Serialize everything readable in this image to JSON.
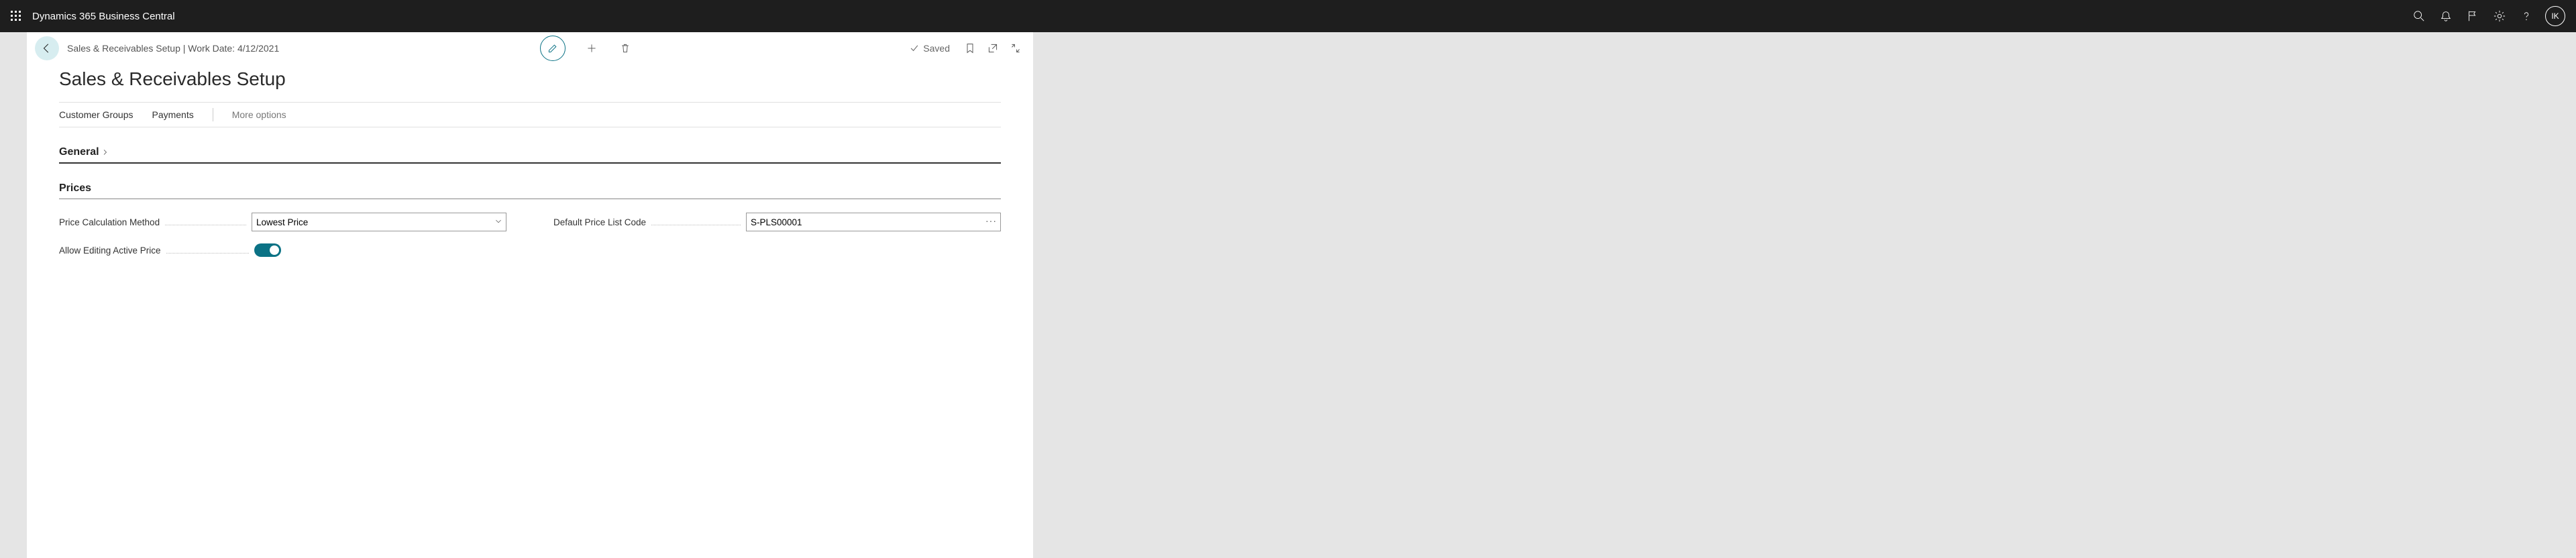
{
  "topbar": {
    "app_title": "Dynamics 365 Business Central",
    "user_initials": "IK"
  },
  "page": {
    "breadcrumb": "Sales & Receivables Setup | Work Date: 4/12/2021",
    "title": "Sales & Receivables Setup",
    "saved_label": "Saved"
  },
  "tabs": {
    "items": [
      "Customer Groups",
      "Payments"
    ],
    "more": "More options"
  },
  "sections": {
    "general": "General",
    "prices": "Prices"
  },
  "fields": {
    "price_calc_method": {
      "label": "Price Calculation Method",
      "value": "Lowest Price"
    },
    "default_price_list": {
      "label": "Default Price List Code",
      "value": "S-PLS00001"
    },
    "allow_editing": {
      "label": "Allow Editing Active Price",
      "value": true
    }
  }
}
